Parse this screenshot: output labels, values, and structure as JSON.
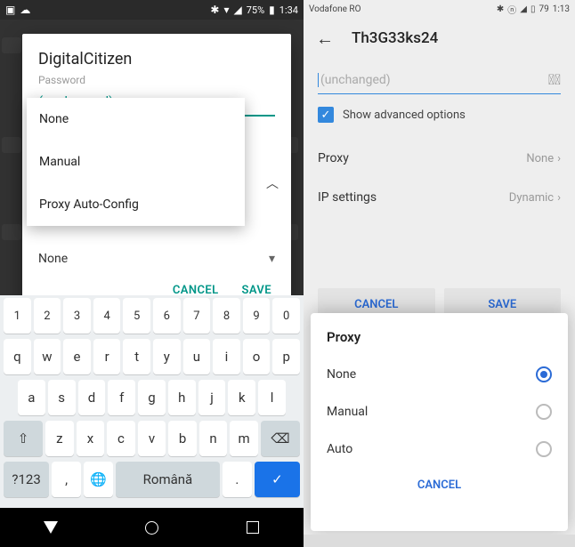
{
  "left": {
    "status": {
      "battery": "75%",
      "time": "1:34"
    },
    "dialog": {
      "title": "DigitalCitizen",
      "password_label": "Password",
      "password_value": "(unchanged)",
      "proxy_menu": [
        "None",
        "Manual",
        "Proxy Auto-Config"
      ],
      "select_value": "None",
      "cancel": "CANCEL",
      "save": "SAVE"
    },
    "keyboard": {
      "row_num": [
        "1",
        "2",
        "3",
        "4",
        "5",
        "6",
        "7",
        "8",
        "9",
        "0"
      ],
      "row1": [
        "q",
        "w",
        "e",
        "r",
        "t",
        "y",
        "u",
        "i",
        "o",
        "p"
      ],
      "row2": [
        "a",
        "s",
        "d",
        "f",
        "g",
        "h",
        "j",
        "k",
        "l"
      ],
      "row3": [
        "z",
        "x",
        "c",
        "v",
        "b",
        "n",
        "m"
      ],
      "symbols_key": "?123",
      "comma": ",",
      "period": ".",
      "space_label": "Română"
    }
  },
  "right": {
    "status": {
      "carrier": "Vodafone RO",
      "battery": "79",
      "time": "1:13"
    },
    "header": {
      "title": "Th3G33ks24"
    },
    "password_placeholder": "(unchanged)",
    "show_advanced": "Show advanced options",
    "rows": {
      "proxy_label": "Proxy",
      "proxy_value": "None",
      "ip_label": "IP settings",
      "ip_value": "Dynamic"
    },
    "buttons": {
      "cancel": "CANCEL",
      "save": "SAVE"
    },
    "sheet": {
      "title": "Proxy",
      "options": {
        "none": "None",
        "manual": "Manual",
        "auto": "Auto"
      },
      "cancel": "CANCEL"
    }
  }
}
